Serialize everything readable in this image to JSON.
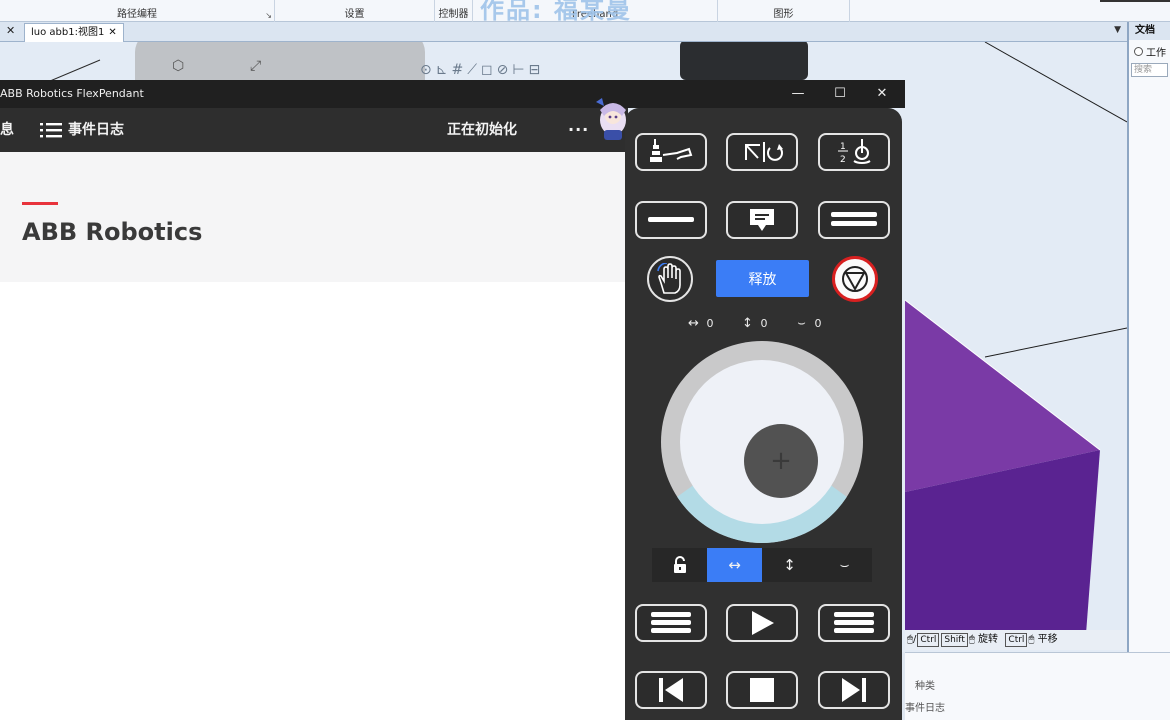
{
  "robotstudio": {
    "ribbon": {
      "groups": [
        "路径编程",
        "设置",
        "控制器",
        "图形"
      ],
      "freehand_label": "Freehand",
      "watermark": "作品: 福某曼"
    },
    "doc_tab": {
      "close_left": "✕",
      "label": "luo abb1:视图1",
      "close": "✕"
    },
    "right_panel": {
      "header": "文档",
      "option": "工作",
      "search_placeholder": "搜索"
    },
    "status_bar": {
      "rotate_label": "旋转",
      "pan_label": "平移",
      "key_ctrl": "Ctrl",
      "key_shift": "Shift"
    },
    "output": {
      "column_type": "种类",
      "event_log": "事件日志"
    }
  },
  "flexpendant": {
    "window_title": "ABB Robotics FlexPendant",
    "controls": {
      "minimize": "—",
      "maximize": "☐",
      "close": "✕"
    },
    "toolbar": {
      "info_label": "信息",
      "event_log_label": "事件日志",
      "status": "正在初始化",
      "more": "···"
    },
    "hero": {
      "title": "ABB Robotics"
    },
    "jog": {
      "release_label": "释放",
      "axis_values": {
        "x": "0",
        "y": "0",
        "rot": "0"
      },
      "modes": [
        "lock",
        "horizontal",
        "vertical",
        "rotate"
      ],
      "active_mode": "horizontal",
      "joystick_icon": "plus-icon"
    }
  },
  "colors": {
    "accent_blue": "#3b7df6",
    "accent_red": "#e8333c",
    "estop_red": "#d82020",
    "panel_dark": "#303030",
    "cube_purple": "#6a2f9e",
    "joystick_arc": "#b3dbe6"
  }
}
